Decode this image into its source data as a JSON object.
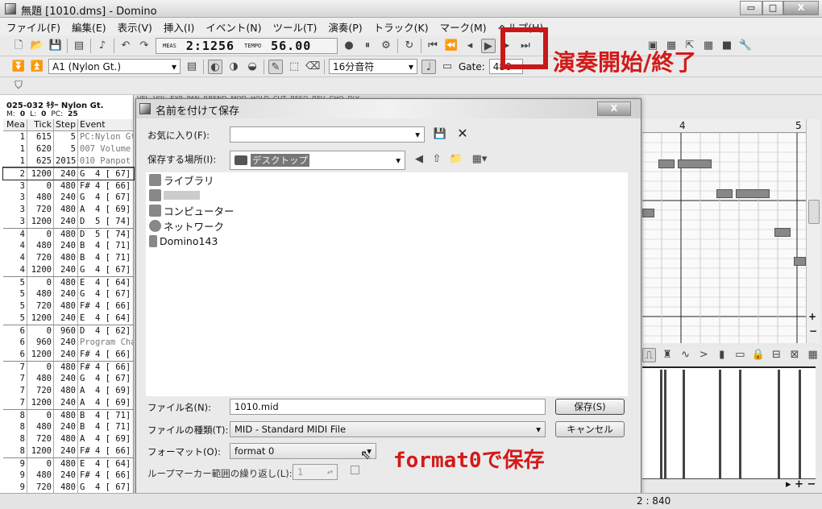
{
  "window": {
    "title": "無題 [1010.dms] - Domino",
    "minimize": "▭",
    "maximize": "□",
    "close": "X"
  },
  "menu": [
    "ファイル(F)",
    "編集(E)",
    "表示(V)",
    "挿入(I)",
    "イベント(N)",
    "ツール(T)",
    "演奏(P)",
    "トラック(K)",
    "マーク(M)",
    "ヘルプ(H)"
  ],
  "toolbar": {
    "meas_label": "MEAS",
    "meas_value": "2:1256",
    "tempo_label": "TEMPO",
    "tempo_value": "56.00",
    "track_select": "A1 (Nylon Gt.)",
    "note_length": "16分音符",
    "gate_label": "Gate:",
    "gate_value": "480"
  },
  "track_info": {
    "name": "025-032 ｷﾀｰ Nylon Gt.",
    "m_label": "M:",
    "m_value": "0",
    "l_label": "L:",
    "l_value": "0",
    "pc_label": "PC:",
    "pc_value": "25"
  },
  "controller_header": "VEL  VOL  EXP  PAN  P.BEND  MOD  HOLD  CUT  RESO  REV  CHO  DLY",
  "event_list": {
    "columns": [
      "Mea",
      "Tick",
      "Step",
      "Event"
    ],
    "rows": [
      [
        "1",
        "615",
        "5",
        "PC:Nylon Gt"
      ],
      [
        "1",
        "620",
        "5",
        "007 Volume"
      ],
      [
        "1",
        "625",
        "2015",
        "010 Panpot"
      ],
      [
        "2",
        "1200",
        "240",
        "G  4 [ 67]"
      ],
      [
        "3",
        "0",
        "480",
        "F# 4 [ 66]"
      ],
      [
        "3",
        "480",
        "240",
        "G  4 [ 67]"
      ],
      [
        "3",
        "720",
        "480",
        "A  4 [ 69]"
      ],
      [
        "3",
        "1200",
        "240",
        "D  5 [ 74]"
      ],
      [
        "4",
        "0",
        "480",
        "D  5 [ 74]"
      ],
      [
        "4",
        "480",
        "240",
        "B  4 [ 71]"
      ],
      [
        "4",
        "720",
        "480",
        "B  4 [ 71]"
      ],
      [
        "4",
        "1200",
        "240",
        "G  4 [ 67]"
      ],
      [
        "5",
        "0",
        "480",
        "E  4 [ 64]"
      ],
      [
        "5",
        "480",
        "240",
        "G  4 [ 67]"
      ],
      [
        "5",
        "720",
        "480",
        "F# 4 [ 66]"
      ],
      [
        "5",
        "1200",
        "240",
        "E  4 [ 64]"
      ],
      [
        "6",
        "0",
        "960",
        "D  4 [ 62]"
      ],
      [
        "6",
        "960",
        "240",
        "Program Change"
      ],
      [
        "6",
        "1200",
        "240",
        "F# 4 [ 66]"
      ],
      [
        "7",
        "0",
        "480",
        "F# 4 [ 66]"
      ],
      [
        "7",
        "480",
        "240",
        "G  4 [ 67]"
      ],
      [
        "7",
        "720",
        "480",
        "A  4 [ 69]"
      ],
      [
        "7",
        "1200",
        "240",
        "A  4 [ 69]"
      ],
      [
        "8",
        "0",
        "480",
        "B  4 [ 71]"
      ],
      [
        "8",
        "480",
        "240",
        "B  4 [ 71]"
      ],
      [
        "8",
        "720",
        "480",
        "A  4 [ 69]"
      ],
      [
        "8",
        "1200",
        "240",
        "F# 4 [ 66]"
      ],
      [
        "9",
        "0",
        "480",
        "E  4 [ 64]"
      ],
      [
        "9",
        "480",
        "240",
        "F# 4 [ 66]"
      ],
      [
        "9",
        "720",
        "480",
        "G  4 [ 67]"
      ]
    ]
  },
  "dialog": {
    "title": "名前を付けて保存",
    "close": "X",
    "favorites_label": "お気に入り(F):",
    "favorites_value": "",
    "location_label": "保存する場所(I):",
    "location_value": "デスクトップ",
    "places": [
      "ライブラリ",
      "",
      "コンピューター",
      "ネットワーク",
      "Domino143"
    ],
    "filename_label": "ファイル名(N):",
    "filename_value": "1010.mid",
    "filetype_label": "ファイルの種類(T):",
    "filetype_value": "MID - Standard MIDI File",
    "format_label": "フォーマット(O):",
    "format_value": "format 0",
    "loop_label": "ループマーカー範囲の繰り返し(L):",
    "loop_value": "1",
    "save_button": "保存(S)",
    "cancel_button": "キャンセル"
  },
  "piano_roll": {
    "measure_labels": [
      "4",
      "5"
    ]
  },
  "annotations": {
    "play_note": "演奏開始/終了",
    "format_note": "format0で保存",
    "color": "#d21a1a"
  },
  "status": {
    "position": "2 : 840"
  }
}
